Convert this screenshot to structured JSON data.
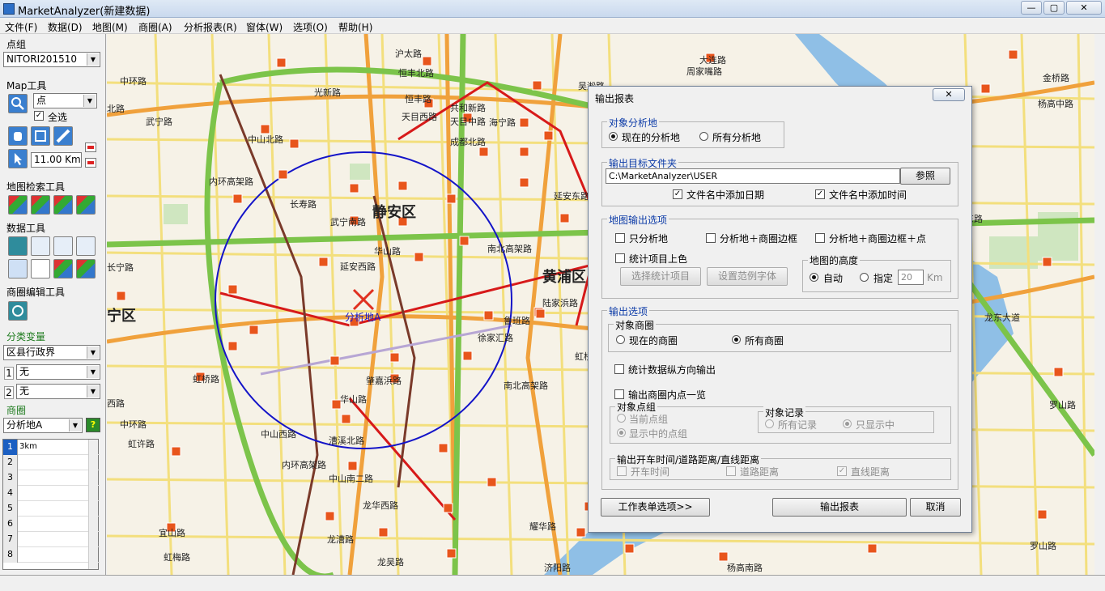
{
  "window": {
    "title": "MarketAnalyzer(新建数据)",
    "min": "—",
    "max": "▢",
    "close": "✕"
  },
  "menu": [
    "文件(F)",
    "数据(D)",
    "地图(M)",
    "商圈(A)",
    "分析报表(R)",
    "窗体(W)",
    "选项(O)",
    "帮助(H)"
  ],
  "left": {
    "point_group_label": "点组",
    "point_group_value": "NITORI201510",
    "map_tools_label": "Map工具",
    "map_tool_type": "点",
    "select_all": "全选",
    "distance": "11.00 Km",
    "map_search_label": "地图检索工具",
    "data_tools_label": "数据工具",
    "area_edit_label": "商圈编辑工具",
    "classify_label": "分类变量",
    "classify_value": "区县行政界",
    "row1_num": "1",
    "row1_value": "无",
    "row2_num": "2",
    "row2_value": "无",
    "area_label": "商圈",
    "area_value": "分析地A",
    "help": "?",
    "grid_rows": [
      {
        "n": "1",
        "v": "3km"
      },
      {
        "n": "2",
        "v": ""
      },
      {
        "n": "3",
        "v": ""
      },
      {
        "n": "4",
        "v": ""
      },
      {
        "n": "5",
        "v": ""
      },
      {
        "n": "6",
        "v": ""
      },
      {
        "n": "7",
        "v": ""
      },
      {
        "n": "8",
        "v": ""
      }
    ]
  },
  "map": {
    "districts": [
      "静安区",
      "黄浦区",
      "宁区"
    ],
    "roads": [
      "沪太路",
      "恒丰北路",
      "恒丰路",
      "天目西路",
      "共和新路",
      "天目中路",
      "海宁路",
      "成都北路",
      "光新路",
      "中山北路",
      "武宁路",
      "中环路",
      "武宁南路",
      "长寿路",
      "内环高架路",
      "华山路",
      "延安西路",
      "南北高架路",
      "陆家浜路",
      "鲁班路",
      "徐家汇路",
      "肇嘉浜路",
      "华山路",
      "虹桥路",
      "中山西路",
      "漕溪北路",
      "内环高架路",
      "中山南二路",
      "龙华西路",
      "龙吴路",
      "龙漕路",
      "宜山路",
      "虹梅路",
      "中环路",
      "虹许路",
      "金桥路",
      "杨高中路",
      "龙东大道",
      "罗山路",
      "罗山路",
      "杨高南路",
      "济阳路",
      "耀华路",
      "南北高架路",
      "延安东路",
      "周家嘴路",
      "大连路",
      "吴淞路",
      "长宁路",
      "北路",
      "东路",
      "虹桥路",
      "西路"
    ],
    "center_label": "分析地A"
  },
  "dialog": {
    "title": "输出报表",
    "close": "✕",
    "target_group": "对象分析地",
    "radio_current": "现在的分析地",
    "radio_all": "所有分析地",
    "folder_group": "输出目标文件夹",
    "folder_path": "C:\\MarketAnalyzer\\USER",
    "browse": "参照",
    "chk_date": "文件名中添加日期",
    "chk_time": "文件名中添加时间",
    "map_out_group": "地图输出选项",
    "only_site": "只分析地",
    "site_frame": "分析地＋商圈边框",
    "site_frame_point": "分析地＋商圈边框＋点",
    "stat_color": "统计项目上色",
    "select_stat": "选择统计项目",
    "set_font": "设置范例字体",
    "height_group": "地图的高度",
    "auto": "自动",
    "specify": "指定",
    "height_value": "20",
    "km": "Km",
    "output_opts": "输出选项",
    "target_area": "对象商圈",
    "current_area": "现在的商圈",
    "all_area": "所有商圈",
    "stat_vertical": "统计数据纵方向输出",
    "point_list": "输出商圈内点一览",
    "target_point_group": "对象点组",
    "current_group": "当前点组",
    "shown_group": "显示中的点组",
    "target_record": "对象记录",
    "all_records": "所有记录",
    "shown_only": "只显示中",
    "dist_group": "输出开车时间/道路距离/直线距离",
    "drive_time": "开车时间",
    "road_dist": "道路距离",
    "straight_dist": "直线距离",
    "sheet_opts": "工作表单选项>>",
    "output_btn": "输出报表",
    "cancel": "取消"
  },
  "colors": {
    "accent": "#0b3aa7",
    "circle": "#1414c8",
    "metro": "#d71a1a",
    "road_green": "#7cc44a",
    "road_orange": "#f0a13c"
  }
}
